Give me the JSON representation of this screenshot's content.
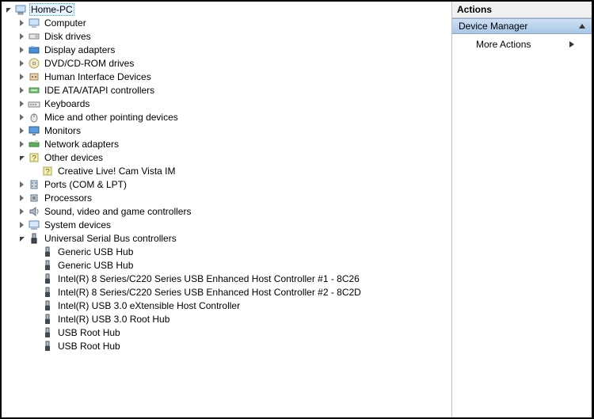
{
  "root": {
    "label": "Home-PC"
  },
  "categories": [
    {
      "label": "Computer",
      "icon": "computer"
    },
    {
      "label": "Disk drives",
      "icon": "disk"
    },
    {
      "label": "Display adapters",
      "icon": "display"
    },
    {
      "label": "DVD/CD-ROM drives",
      "icon": "dvd"
    },
    {
      "label": "Human Interface Devices",
      "icon": "hid"
    },
    {
      "label": "IDE ATA/ATAPI controllers",
      "icon": "ide"
    },
    {
      "label": "Keyboards",
      "icon": "keyboard"
    },
    {
      "label": "Mice and other pointing devices",
      "icon": "mouse"
    },
    {
      "label": "Monitors",
      "icon": "monitor"
    },
    {
      "label": "Network adapters",
      "icon": "network"
    }
  ],
  "other_devices": {
    "label": "Other devices",
    "child": "Creative Live! Cam Vista IM"
  },
  "categories2": [
    {
      "label": "Ports (COM & LPT)",
      "icon": "port"
    },
    {
      "label": "Processors",
      "icon": "cpu"
    },
    {
      "label": "Sound, video and game controllers",
      "icon": "sound"
    },
    {
      "label": "System devices",
      "icon": "system"
    }
  ],
  "usb": {
    "label": "Universal Serial Bus controllers",
    "children": [
      "Generic USB Hub",
      "Generic USB Hub",
      "Intel(R) 8 Series/C220 Series USB Enhanced Host Controller #1 - 8C26",
      "Intel(R) 8 Series/C220 Series USB Enhanced Host Controller #2 - 8C2D",
      "Intel(R) USB 3.0 eXtensible Host Controller",
      "Intel(R) USB 3.0 Root Hub",
      "USB Root Hub",
      "USB Root Hub"
    ]
  },
  "actions": {
    "header": "Actions",
    "section": "Device Manager",
    "more": "More Actions"
  }
}
